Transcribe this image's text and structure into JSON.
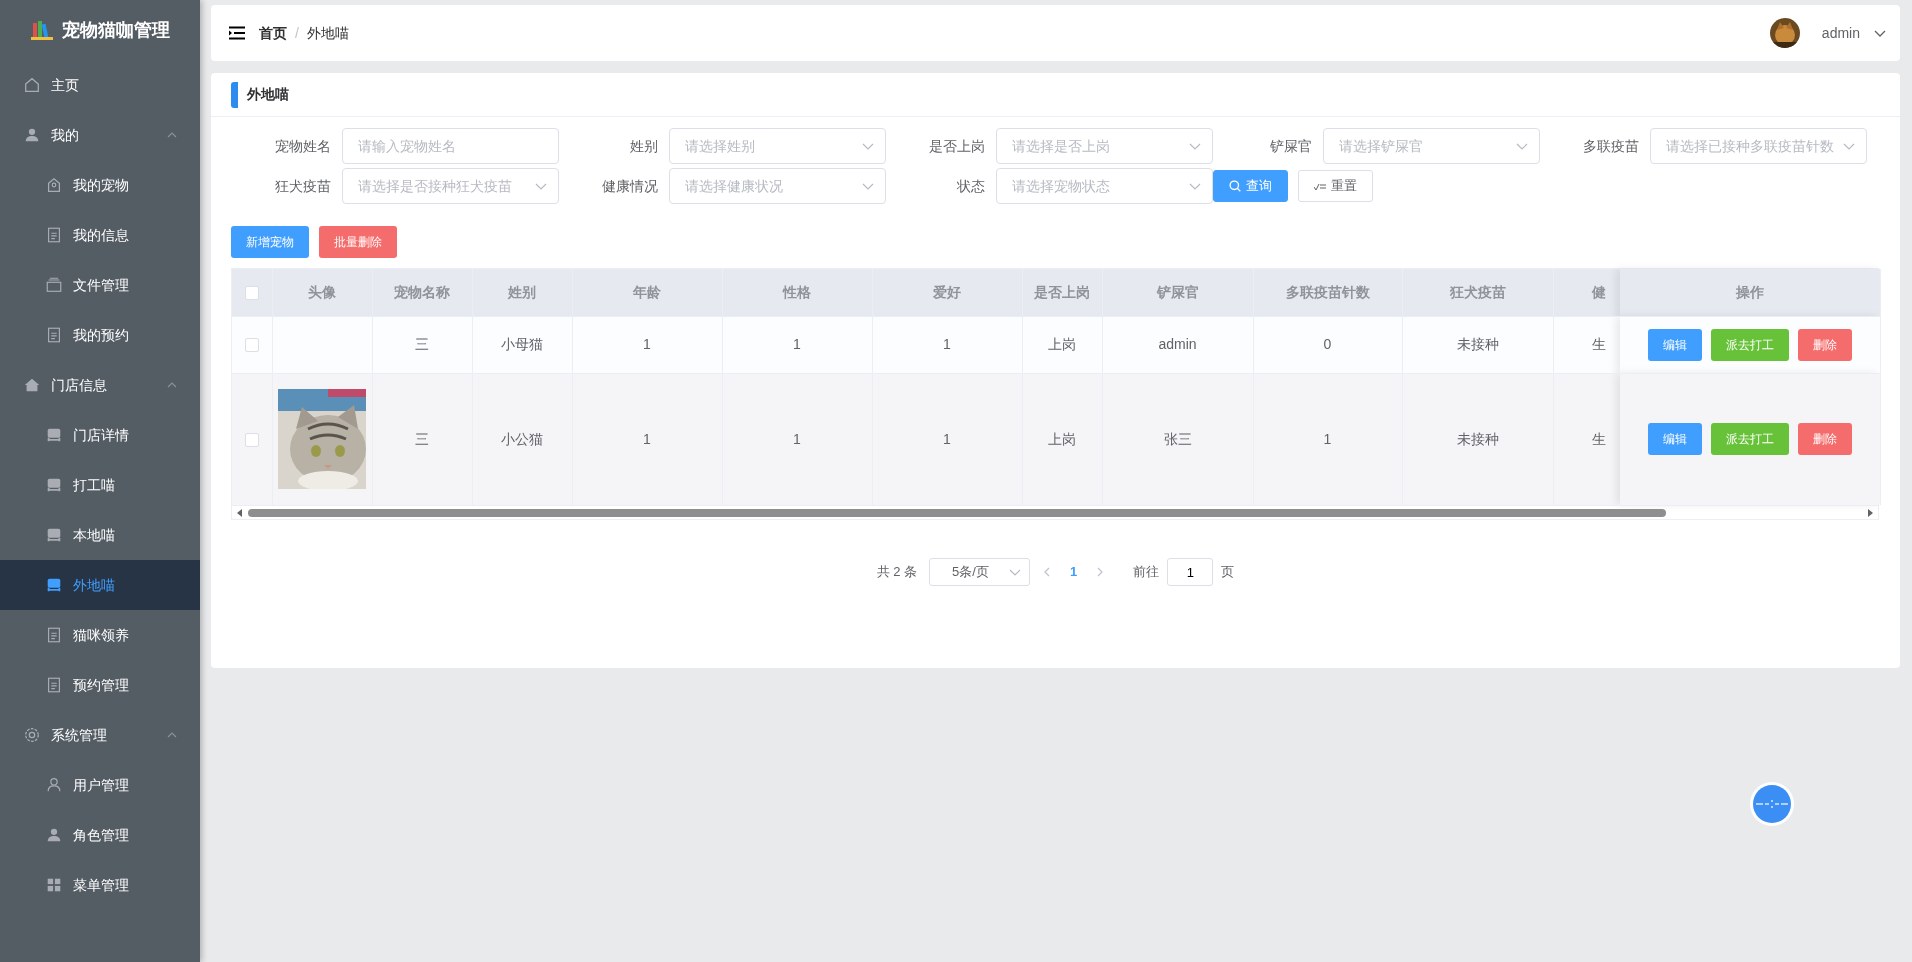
{
  "sidebar": {
    "title": "宠物猫咖管理",
    "items": [
      {
        "label": "主页",
        "selected": false
      },
      {
        "label": "我的",
        "expanded": true,
        "selected": false,
        "children": [
          {
            "label": "我的宠物",
            "selected": false
          },
          {
            "label": "我的信息",
            "selected": false
          },
          {
            "label": "文件管理",
            "selected": false
          },
          {
            "label": "我的预约",
            "selected": false
          }
        ]
      },
      {
        "label": "门店信息",
        "expanded": true,
        "selected": false,
        "children": [
          {
            "label": "门店详情",
            "selected": false
          },
          {
            "label": "打工喵",
            "selected": false
          },
          {
            "label": "本地喵",
            "selected": false
          },
          {
            "label": "外地喵",
            "selected": true
          },
          {
            "label": "猫咪领养",
            "selected": false
          },
          {
            "label": "预约管理",
            "selected": false
          }
        ]
      },
      {
        "label": "系统管理",
        "expanded": true,
        "selected": false,
        "children": [
          {
            "label": "用户管理",
            "selected": false
          },
          {
            "label": "角色管理",
            "selected": false
          },
          {
            "label": "菜单管理",
            "selected": false
          }
        ]
      }
    ]
  },
  "header": {
    "breadcrumb": [
      "首页",
      "外地喵"
    ],
    "separator": "/",
    "user": "admin"
  },
  "panel": {
    "title": "外地喵"
  },
  "filters": [
    {
      "label": "宠物姓名",
      "placeholder": "请输入宠物姓名",
      "kind": "input"
    },
    {
      "label": "姓别",
      "placeholder": "请选择姓别",
      "kind": "select"
    },
    {
      "label": "是否上岗",
      "placeholder": "请选择是否上岗",
      "kind": "select"
    },
    {
      "label": "铲屎官",
      "placeholder": "请选择铲屎官",
      "kind": "select"
    },
    {
      "label": "多联疫苗",
      "placeholder": "请选择已接种多联疫苗针数",
      "kind": "select"
    },
    {
      "label": "狂犬疫苗",
      "placeholder": "请选择是否接种狂犬疫苗",
      "kind": "select"
    },
    {
      "label": "健康情况",
      "placeholder": "请选择健康状况",
      "kind": "select"
    },
    {
      "label": "状态",
      "placeholder": "请选择宠物状态",
      "kind": "select"
    }
  ],
  "search_button": "查询",
  "reset_button": "重置",
  "toolbar": [
    {
      "label": "新增宠物",
      "kind": "primary"
    },
    {
      "label": "批量删除",
      "kind": "danger"
    }
  ],
  "table": {
    "select_all_checked": false,
    "columns": [
      "头像",
      "宠物名称",
      "姓别",
      "年龄",
      "性格",
      "爱好",
      "是否上岗",
      "铲屎官",
      "多联疫苗针数",
      "狂犬疫苗",
      "健",
      "操作"
    ],
    "rows": [
      {
        "checked": false,
        "cells": [
          "",
          "三",
          "小母猫",
          "1",
          "1",
          "1",
          "上岗",
          "admin",
          "0",
          "未接种",
          "生"
        ],
        "actions": [
          {
            "label": "编辑",
            "kind": "primary"
          },
          {
            "label": "派去打工",
            "kind": "success"
          },
          {
            "label": "删除",
            "kind": "danger"
          }
        ]
      },
      {
        "checked": false,
        "avatar": {
          "kind": "picture"
        },
        "cells": [
          "",
          "三",
          "小公猫",
          "1",
          "1",
          "1",
          "上岗",
          "张三",
          "1",
          "未接种",
          "生"
        ],
        "actions": [
          {
            "label": "编辑",
            "kind": "primary"
          },
          {
            "label": "派去打工",
            "kind": "success"
          },
          {
            "label": "删除",
            "kind": "danger"
          }
        ]
      }
    ]
  },
  "pagination": {
    "total": "共 2 条",
    "page_size": "5条/页",
    "pages": [
      {
        "label": "1",
        "selected": true
      }
    ],
    "goto_label": "前往",
    "goto_value": "1",
    "goto_suffix": "页"
  }
}
